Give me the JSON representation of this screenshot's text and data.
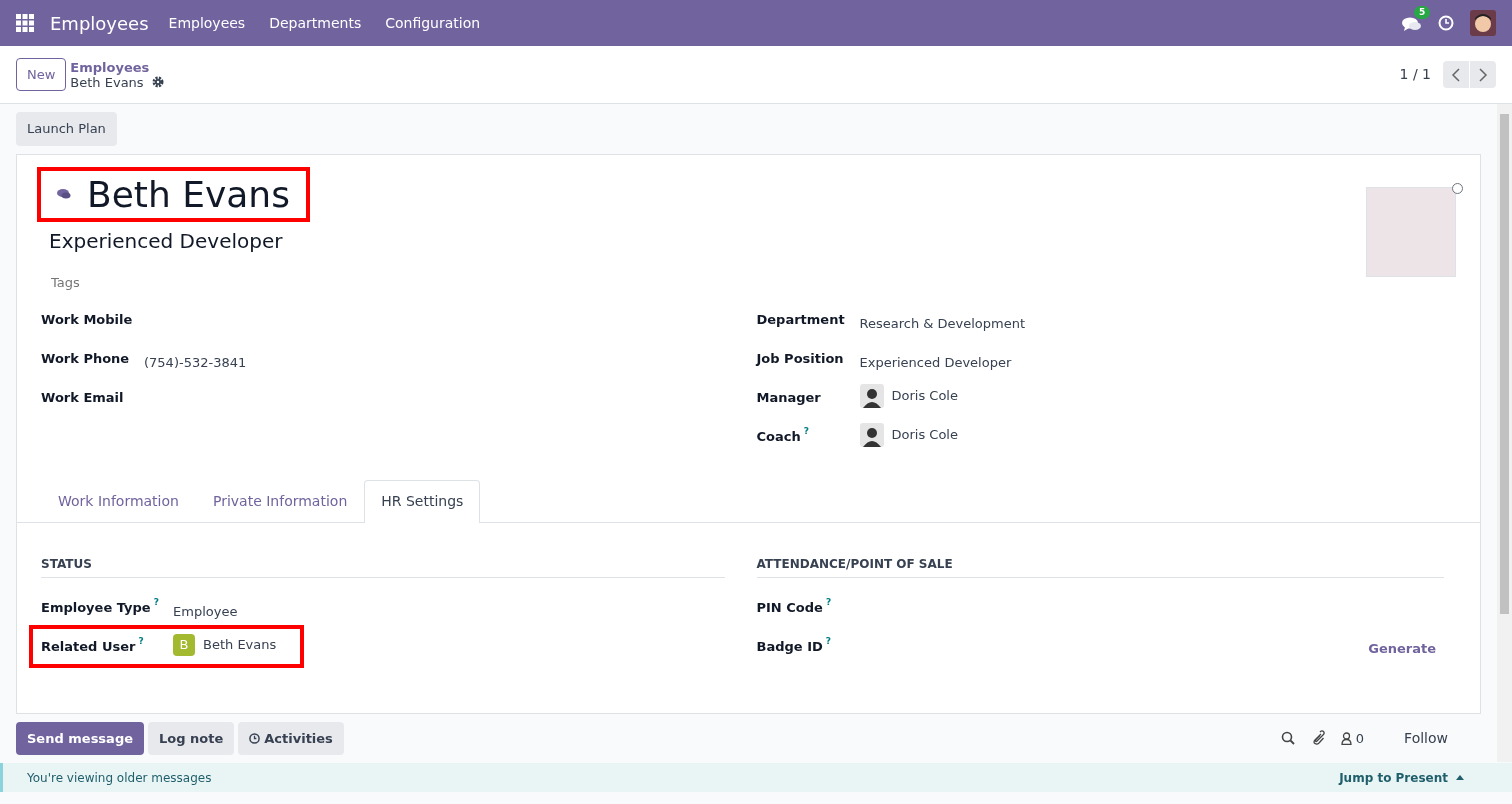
{
  "navbar": {
    "app_name": "Employees",
    "menu": [
      "Employees",
      "Departments",
      "Configuration"
    ],
    "messages_count": "5"
  },
  "control_panel": {
    "new_button": "New",
    "breadcrumb_parent": "Employees",
    "breadcrumb_current": "Beth Evans",
    "pager": "1 / 1"
  },
  "action_buttons": [
    "Launch Plan"
  ],
  "employee": {
    "name": "Beth Evans",
    "name_highlighted": true,
    "job_title": "Experienced Developer",
    "tags_placeholder": "Tags",
    "online": false
  },
  "left_fields": [
    {
      "label": "Work Mobile"
    },
    {
      "label": "Work Phone",
      "value": "(754)-532-3841"
    },
    {
      "label": "Work Email"
    }
  ],
  "right_fields": [
    {
      "label": "Department",
      "value": "Research & Development",
      "kind": "text"
    },
    {
      "label": "Job Position",
      "value": "Experienced Developer",
      "kind": "text"
    },
    {
      "label": "Manager",
      "value": "Doris Cole",
      "kind": "person"
    },
    {
      "label": "Coach",
      "help": "?",
      "value": "Doris Cole",
      "kind": "person"
    }
  ],
  "tabs": [
    {
      "label": "Work Information",
      "selected": false
    },
    {
      "label": "Private Information",
      "selected": false
    },
    {
      "label": "HR Settings",
      "selected": true
    }
  ],
  "sections": [
    {
      "title": "STATUS",
      "fields": [
        {
          "label": "Employee Type",
          "help": "?",
          "value": "Employee",
          "kind": "text"
        },
        {
          "label": "Related User",
          "help": "?",
          "value": "Beth Evans",
          "kind": "user",
          "initial": "B",
          "color": "#a2b930",
          "highlighted": true
        }
      ]
    },
    {
      "title": "ATTENDANCE/POINT OF SALE",
      "fields": [
        {
          "label": "PIN Code",
          "help": "?",
          "kind": "text"
        },
        {
          "label": "Badge ID",
          "help": "?",
          "value": "Generate",
          "kind": "action"
        }
      ]
    }
  ],
  "chatter": {
    "buttons": [
      {
        "label": "Send message",
        "primary": true
      },
      {
        "label": "Log note",
        "primary": false
      },
      {
        "label": "Activities",
        "primary": false
      }
    ],
    "followers_count": "0",
    "follow": "Follow"
  },
  "older_messages": {
    "text": "You're viewing older messages",
    "jump": "Jump to Present"
  }
}
